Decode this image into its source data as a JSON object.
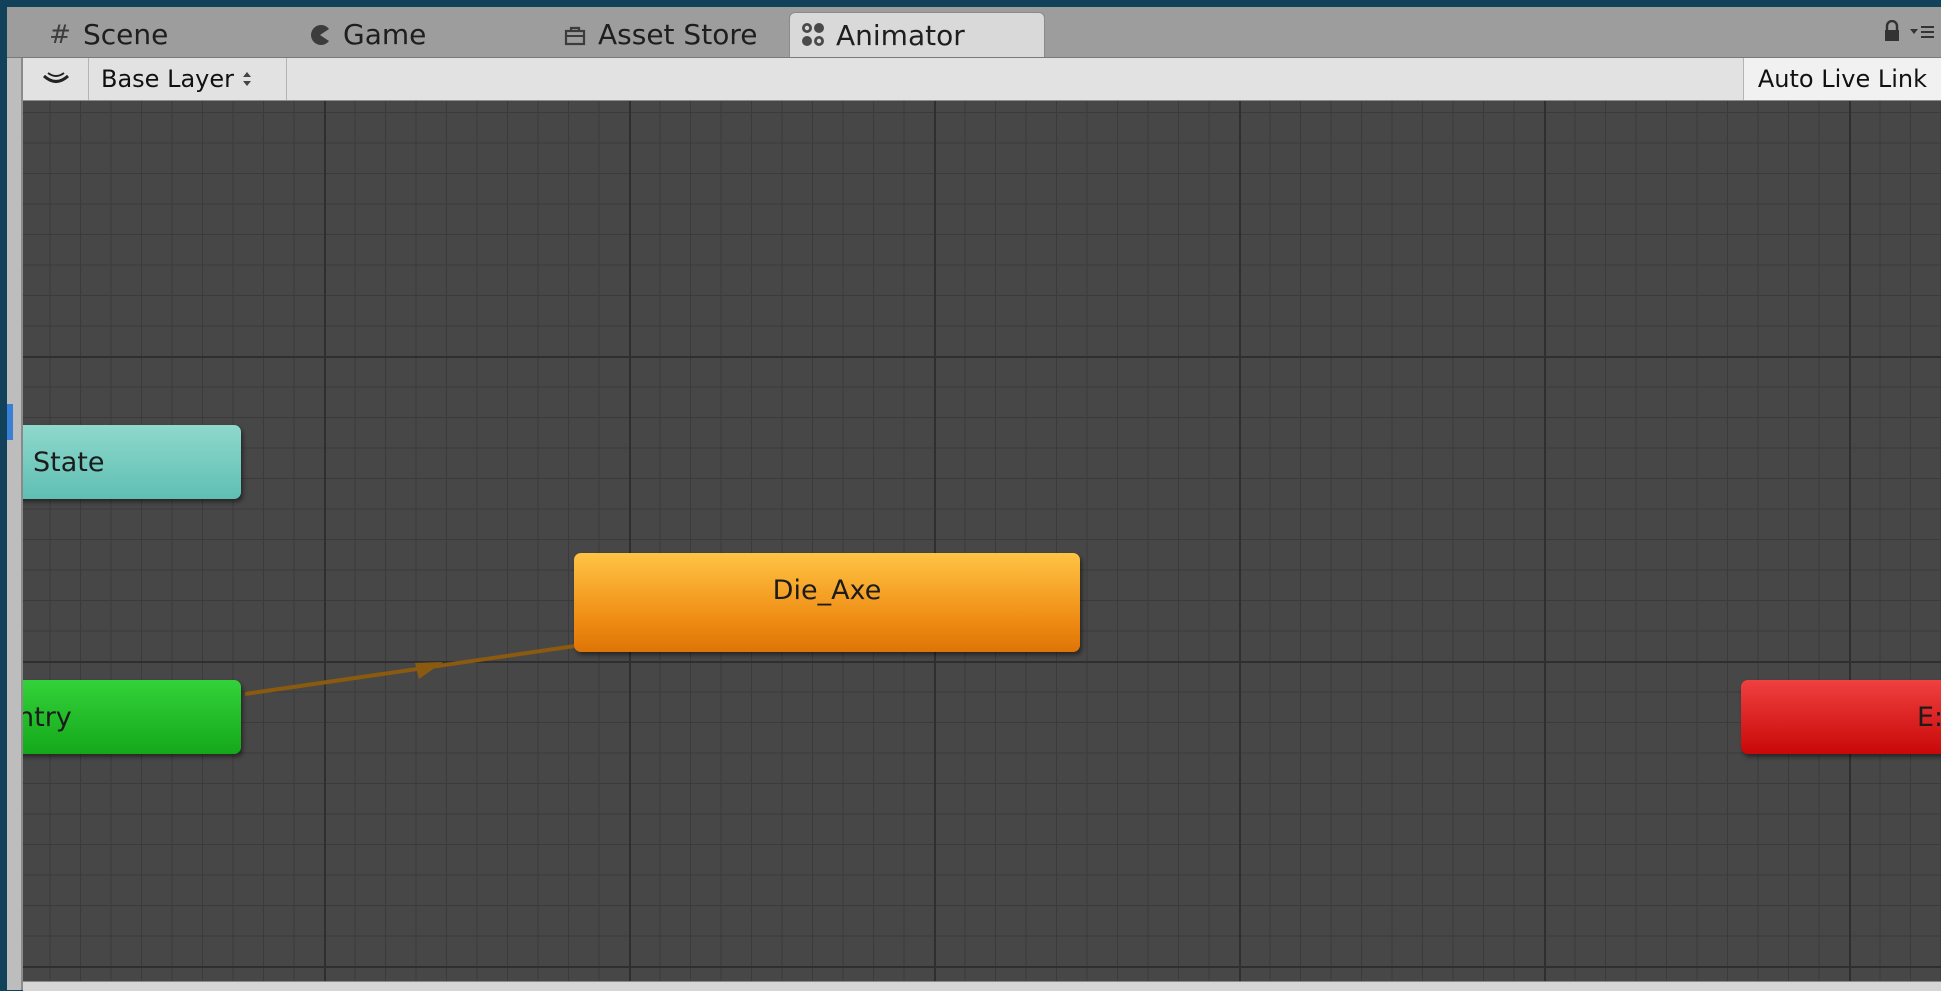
{
  "tabs": [
    {
      "label": "Scene",
      "icon": "hash-icon"
    },
    {
      "label": "Game",
      "icon": "pacman-icon"
    },
    {
      "label": "Asset Store",
      "icon": "store-icon"
    },
    {
      "label": "Animator",
      "icon": "animator-icon",
      "active": true
    }
  ],
  "toolbar": {
    "layer_label": "Base Layer",
    "auto_live_link": "Auto Live Link"
  },
  "nodes": {
    "any_state": "State",
    "entry": "ntry",
    "default_state": "Die_Axe",
    "exit": "E:"
  },
  "colors": {
    "any_state": "#5fbfb3",
    "entry": "#14a81a",
    "default_state": "#ee8a12",
    "exit": "#c90808",
    "transition": "#8a5a10"
  }
}
